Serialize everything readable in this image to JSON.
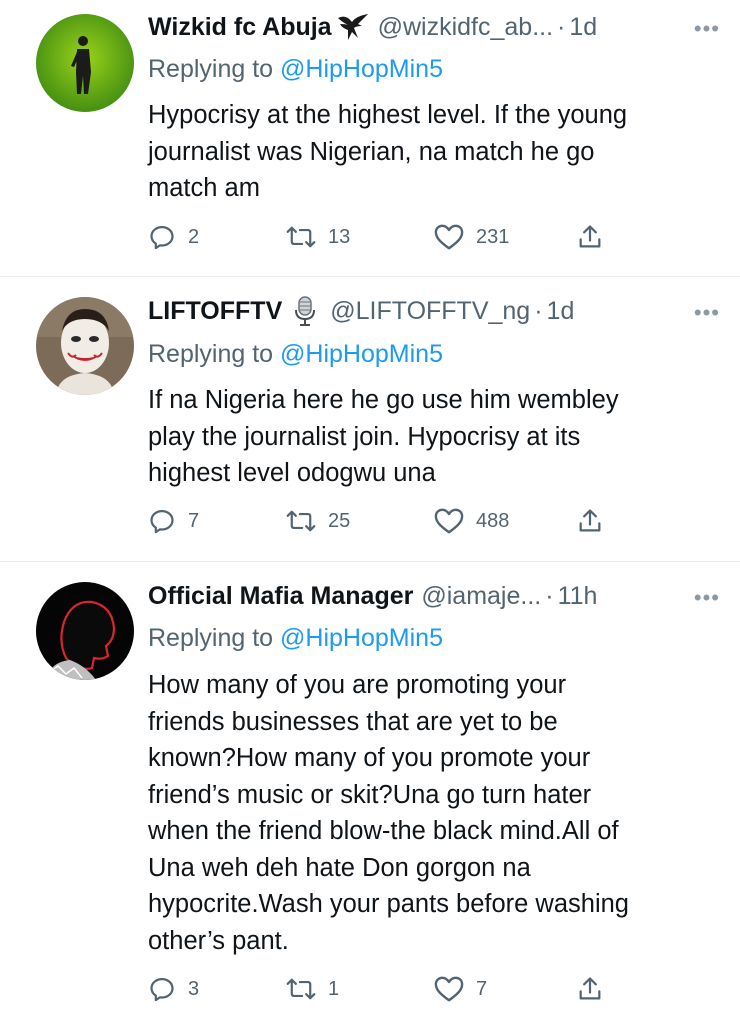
{
  "tweets": [
    {
      "name": "Wizkid fc Abuja",
      "badge_icon": "eagle-icon",
      "handle": "@wizkidfc_ab...",
      "time": "1d",
      "reply_prefix": "Replying to",
      "reply_to": "@HipHopMin5",
      "text_lines": [
        "Hypocrisy at the highest level. If the young",
        "journalist was Nigerian, na match he go",
        "match am"
      ],
      "replies": "2",
      "retweets": "13",
      "likes": "231"
    },
    {
      "name": "LIFTOFFTV",
      "badge_icon": "microphone-icon",
      "handle": "@LIFTOFFTV_ng",
      "time": "1d",
      "reply_prefix": "Replying to",
      "reply_to": "@HipHopMin5",
      "text_lines": [
        "If na Nigeria here he go use him wembley",
        "play the journalist join. Hypocrisy at its",
        "highest level odogwu una"
      ],
      "replies": "7",
      "retweets": "25",
      "likes": "488"
    },
    {
      "name": "Official Mafia Manager",
      "badge_icon": "",
      "handle": "@iamaje...",
      "time": "11h",
      "reply_prefix": "Replying to",
      "reply_to": "@HipHopMin5",
      "text_lines": [
        "How many of you are promoting your",
        "friends businesses that are yet to be",
        "known?How many of you promote your",
        "friend’s music or skit?Una go turn hater",
        "when the friend blow-the black mind.All of",
        "Una weh deh hate Don gorgon na",
        "hypocrite.Wash your pants before washing",
        "other’s pant."
      ],
      "replies": "3",
      "retweets": "1",
      "likes": "7"
    }
  ],
  "ui": {
    "separator": "·",
    "more": "•••",
    "colors": {
      "link": "#1d9bf0",
      "secondary": "#536471",
      "divider": "#e6ecf0"
    }
  }
}
